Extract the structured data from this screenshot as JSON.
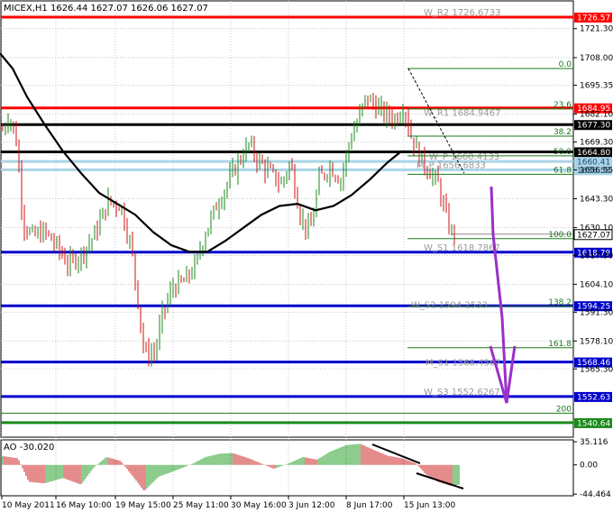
{
  "chart_data": {
    "type": "candlestick",
    "symbol_header": "MICEX,H1  1626.44 1627.07 1626.06 1627.07",
    "ylim": [
      1534,
      1734
    ],
    "y_ticks": [
      "1721.30",
      "1708.00",
      "1695.35",
      "1682.10",
      "1669.30",
      "1656.55",
      "1643.30",
      "1630.10",
      "1617.30",
      "1604.10",
      "1591.30",
      "1578.10",
      "1565.30"
    ],
    "x_ticks": [
      "10 May 2011",
      "16 May 10:00",
      "19 May 15:00",
      "25 May 11:00",
      "30 May 16:00",
      "3 Jun 12:00",
      "8 Jun 17:00",
      "15 Jun 13:00"
    ],
    "price_levels": [
      {
        "value": 1726.57,
        "label": "1726.57",
        "color": "#ff0000"
      },
      {
        "value": 1684.95,
        "label": "1684.95",
        "color": "#ff0000"
      },
      {
        "value": 1677.3,
        "label": "1677.30",
        "color": "#000000"
      },
      {
        "value": 1664.8,
        "label": "1664.80",
        "color": "#000000"
      },
      {
        "value": 1660.41,
        "label": "1660.41",
        "color": "#aad4e6"
      },
      {
        "value": 1656.58,
        "label": "1656.58",
        "color": "#aad4e6"
      },
      {
        "value": 1618.79,
        "label": "1618.79",
        "color": "#0000cc"
      },
      {
        "value": 1594.25,
        "label": "1594.25",
        "color": "#0000cc"
      },
      {
        "value": 1568.46,
        "label": "1568.46",
        "color": "#0000cc"
      },
      {
        "value": 1552.63,
        "label": "1552.63",
        "color": "#0000cc"
      },
      {
        "value": 1540.64,
        "label": "1540.64",
        "color": "#1a8a1a"
      }
    ],
    "current_price": {
      "value": 1627.07,
      "label": "1627.07"
    },
    "pivot_labels": [
      {
        "text": "W_R2 1726.6733",
        "value": 1726.57
      },
      {
        "text": "W_R1 1684.9467",
        "value": 1680.5
      },
      {
        "text": "W_P 1660.4133",
        "value": 1660.41
      },
      {
        "text": "M_P 1656.6833",
        "value": 1656.58
      },
      {
        "text": "W_S1 1618.7867",
        "value": 1618.79
      },
      {
        "text": "W_S2 1594.2533",
        "value": 1592.5
      },
      {
        "text": "M_S1 1568.4567",
        "value": 1566.0
      },
      {
        "text": "W_S3 1552.6267",
        "value": 1552.63
      }
    ],
    "fib_levels": [
      {
        "text": "0.0",
        "value": 1703.0
      },
      {
        "text": "23.6",
        "value": 1684.5
      },
      {
        "text": "38.2",
        "value": 1672.0
      },
      {
        "text": "50.0",
        "value": 1663.0
      },
      {
        "text": "61.8",
        "value": 1654.5
      },
      {
        "text": "100.0",
        "value": 1625.0
      },
      {
        "text": "138.2",
        "value": 1594.0
      },
      {
        "text": "161.8",
        "value": 1575.0
      },
      {
        "text": "200",
        "value": 1545.0
      }
    ],
    "ao": {
      "label": "AO -30.020",
      "ylim": [
        -47,
        38
      ],
      "ticks": [
        "35.116",
        "0.00",
        "-44.464"
      ]
    }
  }
}
